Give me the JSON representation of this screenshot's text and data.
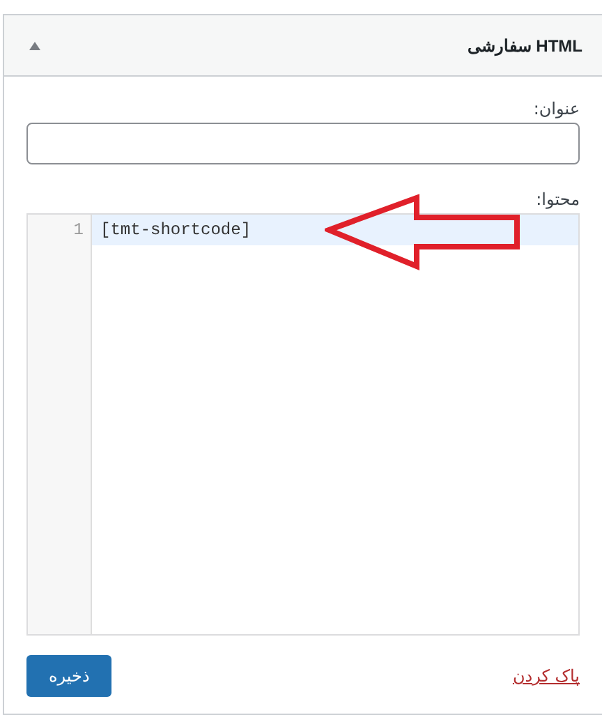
{
  "widget": {
    "title": "HTML سفارشی",
    "expanded": true
  },
  "title_field": {
    "label": "عنوان:"
  },
  "content_field": {
    "label": "محتوا:",
    "lines": [
      {
        "number": "1",
        "text": "[tmt-shortcode]",
        "selected": true
      }
    ]
  },
  "delete_link": "پاک کردن",
  "save_button": "ذخیره"
}
